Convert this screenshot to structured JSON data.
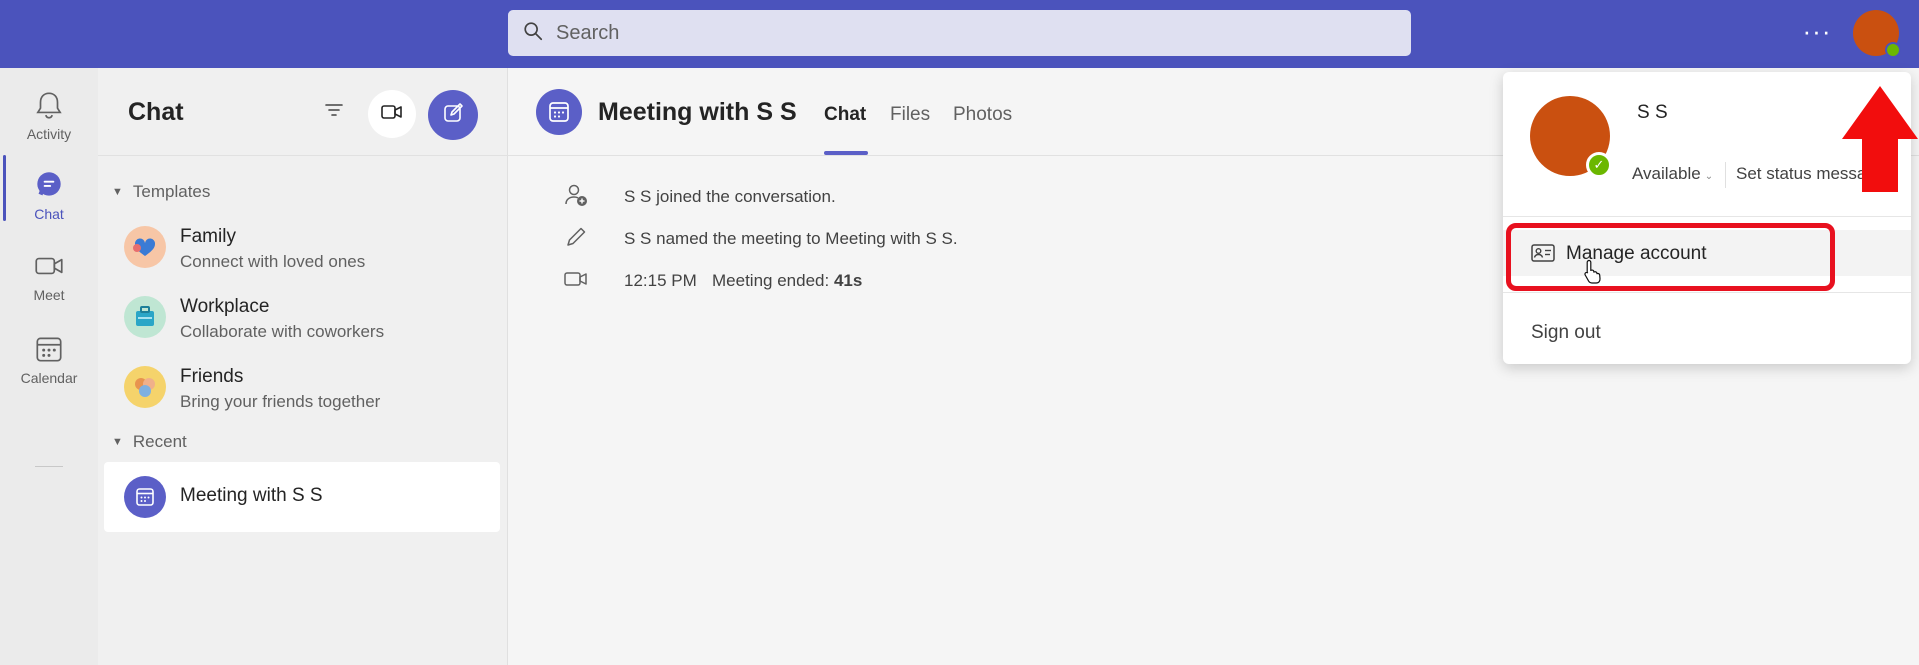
{
  "topbar": {
    "search_placeholder": "Search",
    "more_label": "···"
  },
  "rail": {
    "items": [
      {
        "label": "Activity",
        "icon": "bell-icon"
      },
      {
        "label": "Chat",
        "icon": "chat-icon",
        "active": true
      },
      {
        "label": "Meet",
        "icon": "video-camera-icon"
      },
      {
        "label": "Calendar",
        "icon": "calendar-icon"
      }
    ]
  },
  "chatlist": {
    "title": "Chat",
    "templates_heading": "Templates",
    "templates": [
      {
        "name": "Family",
        "sub": "Connect with loved ones"
      },
      {
        "name": "Workplace",
        "sub": "Collaborate with coworkers"
      },
      {
        "name": "Friends",
        "sub": "Bring your friends together"
      }
    ],
    "recent_heading": "Recent",
    "recent": [
      {
        "name": "Meeting with S S"
      }
    ]
  },
  "main": {
    "title": "Meeting with S S",
    "tabs": [
      "Chat",
      "Files",
      "Photos"
    ],
    "active_tab": "Chat",
    "events": {
      "joined": "S S joined the conversation.",
      "named": "S S named the meeting to Meeting with S S.",
      "time": "12:15 PM",
      "ended_label": "Meeting ended:",
      "ended_duration": "41s"
    }
  },
  "profile_menu": {
    "name": "S S",
    "status": "Available",
    "set_status": "Set status messa",
    "manage_account": "Manage account",
    "sign_out": "Sign out"
  },
  "colors": {
    "brand": "#4b53bc",
    "accent": "#5b5fc7",
    "avatar": "#ca5010",
    "presence_available": "#6bb700",
    "annotation_red": "#e8111f"
  }
}
